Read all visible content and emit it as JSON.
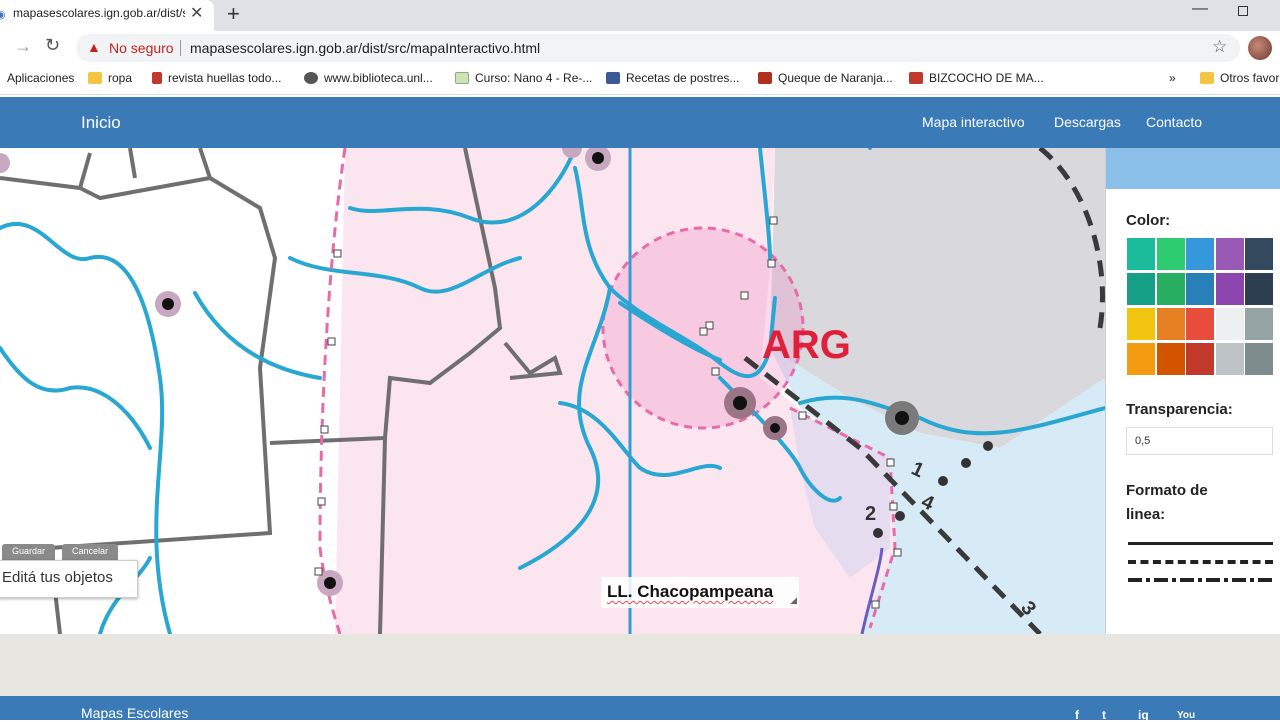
{
  "browser": {
    "tab_title": "mapasescolares.ign.gob.ar/dist/s",
    "not_secure": "No seguro",
    "url": "mapasescolares.ign.gob.ar/dist/src/mapaInteractivo.html",
    "bookmarks": [
      {
        "label": "Aplicaciones",
        "icon": "apps-icon"
      },
      {
        "label": "ropa",
        "icon": "folder-icon"
      },
      {
        "label": "revista huellas todo...",
        "icon": "page-icon"
      },
      {
        "label": "www.biblioteca.unl...",
        "icon": "globe-icon"
      },
      {
        "label": "Curso: Nano 4 - Re-...",
        "icon": "page-icon"
      },
      {
        "label": "Recetas de postres...",
        "icon": "facebook-icon"
      },
      {
        "label": "Queque de Naranja...",
        "icon": "page-icon"
      },
      {
        "label": "BIZCOCHO DE MA...",
        "icon": "page-icon"
      }
    ],
    "more_bookmarks": "»",
    "other_bookmarks": "Otros favor"
  },
  "site": {
    "home": "Inicio",
    "nav": [
      "Mapa interactivo",
      "Descargas",
      "Contacto"
    ],
    "footer_title": "Mapas Escolares",
    "social": [
      "f",
      "t",
      "ig",
      "You"
    ]
  },
  "map": {
    "country_label": "ARG",
    "route_numbers": [
      "1",
      "2",
      "3",
      "4"
    ],
    "buttons": [
      "Guardar",
      "Cancelar"
    ],
    "edit_tip": "Editá tus objetos",
    "user_label": "LL. Chacopampeana"
  },
  "panel": {
    "color_title": "Color:",
    "colors": [
      "#1abc9c",
      "#2ecc71",
      "#3498db",
      "#9b59b6",
      "#34495e",
      "#16a085",
      "#27ae60",
      "#2980b9",
      "#8e44ad",
      "#2c3e50",
      "#f1c40f",
      "#e67e22",
      "#e74c3c",
      "#ecf0f1",
      "#95a5a6",
      "#f39c12",
      "#d35400",
      "#c0392b",
      "#bdc3c7",
      "#7f8c8d"
    ],
    "alpha_title": "Transparencia:",
    "alpha_value": "0,5",
    "line_title_1": "Formato de",
    "line_title_2": "linea:",
    "line_styles": [
      "solid",
      "dashed",
      "dash-dot"
    ]
  }
}
